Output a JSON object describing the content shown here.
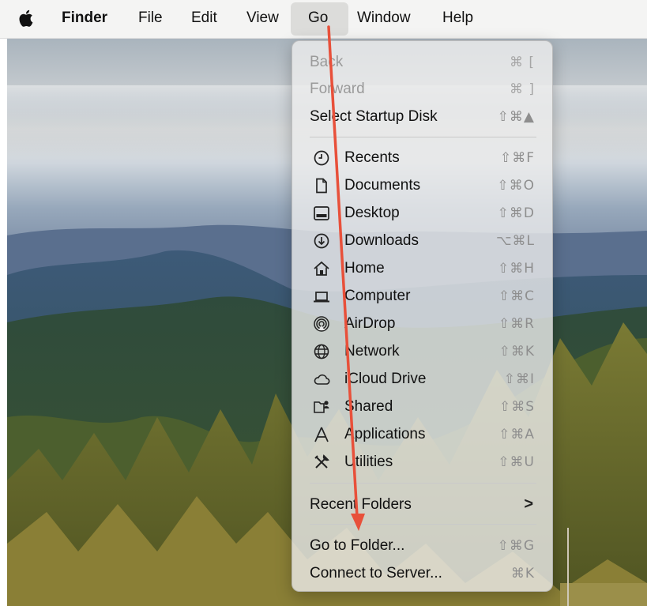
{
  "menubar": {
    "app_name": "Finder",
    "menus": [
      "File",
      "Edit",
      "View",
      "Go",
      "Window",
      "Help"
    ],
    "active_menu": "Go"
  },
  "go_menu": {
    "back": {
      "label": "Back",
      "shortcut": "⌘ [",
      "enabled": false
    },
    "forward": {
      "label": "Forward",
      "shortcut": "⌘ ]",
      "enabled": false
    },
    "startup_disk": {
      "label": "Select Startup Disk",
      "shortcut": "⇧⌘▲"
    },
    "locations": [
      {
        "label": "Recents",
        "shortcut": "⇧⌘F",
        "icon": "clock-icon"
      },
      {
        "label": "Documents",
        "shortcut": "⇧⌘O",
        "icon": "document-icon"
      },
      {
        "label": "Desktop",
        "shortcut": "⇧⌘D",
        "icon": "desktop-icon"
      },
      {
        "label": "Downloads",
        "shortcut": "⌥⌘L",
        "icon": "download-icon"
      },
      {
        "label": "Home",
        "shortcut": "⇧⌘H",
        "icon": "home-icon"
      },
      {
        "label": "Computer",
        "shortcut": "⇧⌘C",
        "icon": "laptop-icon"
      },
      {
        "label": "AirDrop",
        "shortcut": "⇧⌘R",
        "icon": "airdrop-icon"
      },
      {
        "label": "Network",
        "shortcut": "⇧⌘K",
        "icon": "globe-icon"
      },
      {
        "label": "iCloud Drive",
        "shortcut": "⇧⌘I",
        "icon": "cloud-icon"
      },
      {
        "label": "Shared",
        "shortcut": "⇧⌘S",
        "icon": "shared-folder-icon"
      },
      {
        "label": "Applications",
        "shortcut": "⇧⌘A",
        "icon": "applications-icon"
      },
      {
        "label": "Utilities",
        "shortcut": "⇧⌘U",
        "icon": "utilities-icon"
      }
    ],
    "recent_folders": {
      "label": "Recent Folders",
      "submenu_indicator": ">"
    },
    "go_to_folder": {
      "label": "Go to Folder...",
      "shortcut": "⇧⌘G"
    },
    "connect_to_server": {
      "label": "Connect to Server...",
      "shortcut": "⌘K"
    }
  },
  "annotation": {
    "color": "#e8503a"
  }
}
